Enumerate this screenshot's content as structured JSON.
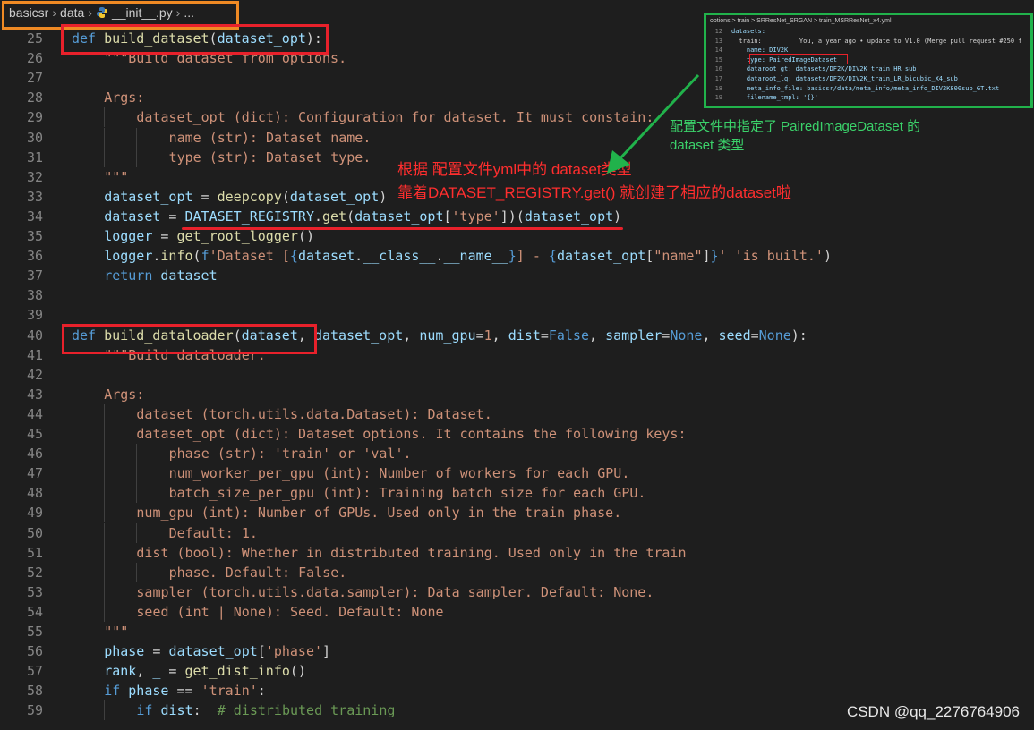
{
  "breadcrumb": {
    "items": [
      "basicsr",
      "data",
      "__init__.py",
      "..."
    ]
  },
  "lines": [
    {
      "n": "25",
      "indent": 0,
      "tokens": [
        [
          "kw",
          "def"
        ],
        [
          "op",
          " "
        ],
        [
          "fn",
          "build_dataset"
        ],
        [
          "op",
          "("
        ],
        [
          "var",
          "dataset_opt"
        ],
        [
          "op",
          "):"
        ]
      ]
    },
    {
      "n": "26",
      "indent": 1,
      "tokens": [
        [
          "doc",
          "\"\"\"Build dataset from options."
        ]
      ]
    },
    {
      "n": "27",
      "indent": 0,
      "tokens": []
    },
    {
      "n": "28",
      "indent": 1,
      "tokens": [
        [
          "doc",
          "Args:"
        ]
      ]
    },
    {
      "n": "29",
      "indent": 2,
      "tokens": [
        [
          "doc",
          "dataset_opt (dict): Configuration for dataset. It must constain:"
        ]
      ]
    },
    {
      "n": "30",
      "indent": 3,
      "tokens": [
        [
          "doc",
          "name (str): Dataset name."
        ]
      ]
    },
    {
      "n": "31",
      "indent": 3,
      "tokens": [
        [
          "doc",
          "type (str): Dataset type."
        ]
      ]
    },
    {
      "n": "32",
      "indent": 1,
      "tokens": [
        [
          "doc",
          "\"\"\""
        ]
      ]
    },
    {
      "n": "33",
      "indent": 1,
      "tokens": [
        [
          "var",
          "dataset_opt"
        ],
        [
          "op",
          " = "
        ],
        [
          "fn",
          "deepcopy"
        ],
        [
          "op",
          "("
        ],
        [
          "var",
          "dataset_opt"
        ],
        [
          "op",
          ")"
        ]
      ]
    },
    {
      "n": "34",
      "indent": 1,
      "tokens": [
        [
          "var",
          "dataset"
        ],
        [
          "op",
          " = "
        ],
        [
          "var",
          "DATASET_REGISTRY"
        ],
        [
          "op",
          "."
        ],
        [
          "fn",
          "get"
        ],
        [
          "op",
          "("
        ],
        [
          "var",
          "dataset_opt"
        ],
        [
          "op",
          "["
        ],
        [
          "str",
          "'type'"
        ],
        [
          "op",
          "])("
        ],
        [
          "var",
          "dataset_opt"
        ],
        [
          "op",
          ")"
        ]
      ]
    },
    {
      "n": "35",
      "indent": 1,
      "tokens": [
        [
          "var",
          "logger"
        ],
        [
          "op",
          " = "
        ],
        [
          "fn",
          "get_root_logger"
        ],
        [
          "op",
          "()"
        ]
      ]
    },
    {
      "n": "36",
      "indent": 1,
      "tokens": [
        [
          "var",
          "logger"
        ],
        [
          "op",
          "."
        ],
        [
          "fn",
          "info"
        ],
        [
          "op",
          "("
        ],
        [
          "kw",
          "f"
        ],
        [
          "str",
          "'Dataset ["
        ],
        [
          "kw",
          "{"
        ],
        [
          "var",
          "dataset"
        ],
        [
          "op",
          "."
        ],
        [
          "var",
          "__class__"
        ],
        [
          "op",
          "."
        ],
        [
          "var",
          "__name__"
        ],
        [
          "kw",
          "}"
        ],
        [
          "str",
          "] - "
        ],
        [
          "kw",
          "{"
        ],
        [
          "var",
          "dataset_opt"
        ],
        [
          "op",
          "["
        ],
        [
          "str",
          "\"name\""
        ],
        [
          "op",
          "]"
        ],
        [
          "kw",
          "}"
        ],
        [
          "str",
          "' "
        ],
        [
          "str",
          "'is built.'"
        ],
        [
          "op",
          ")"
        ]
      ]
    },
    {
      "n": "37",
      "indent": 1,
      "tokens": [
        [
          "kw",
          "return"
        ],
        [
          "op",
          " "
        ],
        [
          "var",
          "dataset"
        ]
      ]
    },
    {
      "n": "38",
      "indent": 0,
      "tokens": []
    },
    {
      "n": "39",
      "indent": 0,
      "tokens": []
    },
    {
      "n": "40",
      "indent": 0,
      "tokens": [
        [
          "kw",
          "def"
        ],
        [
          "op",
          " "
        ],
        [
          "fn",
          "build_dataloader"
        ],
        [
          "op",
          "("
        ],
        [
          "var",
          "dataset"
        ],
        [
          "op",
          ", "
        ],
        [
          "var",
          "dataset_opt"
        ],
        [
          "op",
          ", "
        ],
        [
          "var",
          "num_gpu"
        ],
        [
          "op",
          "="
        ],
        [
          "str",
          "1"
        ],
        [
          "op",
          ", "
        ],
        [
          "var",
          "dist"
        ],
        [
          "op",
          "="
        ],
        [
          "kw",
          "False"
        ],
        [
          "op",
          ", "
        ],
        [
          "var",
          "sampler"
        ],
        [
          "op",
          "="
        ],
        [
          "kw",
          "None"
        ],
        [
          "op",
          ", "
        ],
        [
          "var",
          "seed"
        ],
        [
          "op",
          "="
        ],
        [
          "kw",
          "None"
        ],
        [
          "op",
          "):"
        ]
      ]
    },
    {
      "n": "41",
      "indent": 1,
      "tokens": [
        [
          "doc",
          "\"\"\"Build dataloader."
        ]
      ]
    },
    {
      "n": "42",
      "indent": 0,
      "tokens": []
    },
    {
      "n": "43",
      "indent": 1,
      "tokens": [
        [
          "doc",
          "Args:"
        ]
      ]
    },
    {
      "n": "44",
      "indent": 2,
      "tokens": [
        [
          "doc",
          "dataset (torch.utils.data.Dataset): Dataset."
        ]
      ]
    },
    {
      "n": "45",
      "indent": 2,
      "tokens": [
        [
          "doc",
          "dataset_opt (dict): Dataset options. It contains the following keys:"
        ]
      ]
    },
    {
      "n": "46",
      "indent": 3,
      "tokens": [
        [
          "doc",
          "phase (str): 'train' or 'val'."
        ]
      ]
    },
    {
      "n": "47",
      "indent": 3,
      "tokens": [
        [
          "doc",
          "num_worker_per_gpu (int): Number of workers for each GPU."
        ]
      ]
    },
    {
      "n": "48",
      "indent": 3,
      "tokens": [
        [
          "doc",
          "batch_size_per_gpu (int): Training batch size for each GPU."
        ]
      ]
    },
    {
      "n": "49",
      "indent": 2,
      "tokens": [
        [
          "doc",
          "num_gpu (int): Number of GPUs. Used only in the train phase."
        ]
      ]
    },
    {
      "n": "50",
      "indent": 3,
      "tokens": [
        [
          "doc",
          "Default: 1."
        ]
      ]
    },
    {
      "n": "51",
      "indent": 2,
      "tokens": [
        [
          "doc",
          "dist (bool): Whether in distributed training. Used only in the train"
        ]
      ]
    },
    {
      "n": "52",
      "indent": 3,
      "tokens": [
        [
          "doc",
          "phase. Default: False."
        ]
      ]
    },
    {
      "n": "53",
      "indent": 2,
      "tokens": [
        [
          "doc",
          "sampler (torch.utils.data.sampler): Data sampler. Default: None."
        ]
      ]
    },
    {
      "n": "54",
      "indent": 2,
      "tokens": [
        [
          "doc",
          "seed (int | None): Seed. Default: None"
        ]
      ]
    },
    {
      "n": "55",
      "indent": 1,
      "tokens": [
        [
          "doc",
          "\"\"\""
        ]
      ]
    },
    {
      "n": "56",
      "indent": 1,
      "tokens": [
        [
          "var",
          "phase"
        ],
        [
          "op",
          " = "
        ],
        [
          "var",
          "dataset_opt"
        ],
        [
          "op",
          "["
        ],
        [
          "str",
          "'phase'"
        ],
        [
          "op",
          "]"
        ]
      ]
    },
    {
      "n": "57",
      "indent": 1,
      "tokens": [
        [
          "var",
          "rank"
        ],
        [
          "op",
          ", "
        ],
        [
          "var",
          "_"
        ],
        [
          "op",
          " = "
        ],
        [
          "fn",
          "get_dist_info"
        ],
        [
          "op",
          "()"
        ]
      ]
    },
    {
      "n": "58",
      "indent": 1,
      "tokens": [
        [
          "kw",
          "if"
        ],
        [
          "op",
          " "
        ],
        [
          "var",
          "phase"
        ],
        [
          "op",
          " == "
        ],
        [
          "str",
          "'train'"
        ],
        [
          "op",
          ":"
        ]
      ]
    },
    {
      "n": "59",
      "indent": 2,
      "tokens": [
        [
          "kw",
          "if"
        ],
        [
          "op",
          " "
        ],
        [
          "var",
          "dist"
        ],
        [
          "op",
          ":  "
        ],
        [
          "cmt",
          "# distributed training"
        ]
      ]
    }
  ],
  "annotations": {
    "red_line1": "根据 配置文件yml中的 dataset类型",
    "red_line2": "靠着DATASET_REGISTRY.get() 就创建了相应的dataset啦",
    "green_line1": "配置文件中指定了 PairedImageDataset 的",
    "green_line2": "dataset 类型"
  },
  "mini_editor": {
    "breadcrumb": "options > train > SRResNet_SRGAN > train_MSRResNet_x4.yml",
    "lines": [
      {
        "n": "12",
        "text": "datasets:"
      },
      {
        "n": "13",
        "text": "  train:          You, a year ago • update to V1.0 (Merge pull request #250 f"
      },
      {
        "n": "14",
        "text": "    name: DIV2K"
      },
      {
        "n": "15",
        "text": "    type: PairedImageDataset"
      },
      {
        "n": "16",
        "text": "    dataroot_gt: datasets/DF2K/DIV2K_train_HR_sub"
      },
      {
        "n": "17",
        "text": "    dataroot_lq: datasets/DF2K/DIV2K_train_LR_bicubic_X4_sub"
      },
      {
        "n": "18",
        "text": "    meta_info_file: basicsr/data/meta_info/meta_info_DIV2K800sub_GT.txt"
      },
      {
        "n": "19",
        "text": "    filename_tmpl: '{}'"
      }
    ]
  },
  "watermark": "CSDN @qq_2276764906",
  "colors": {
    "red": "#e8212b",
    "orange": "#f08a24",
    "green": "#21b24b"
  }
}
